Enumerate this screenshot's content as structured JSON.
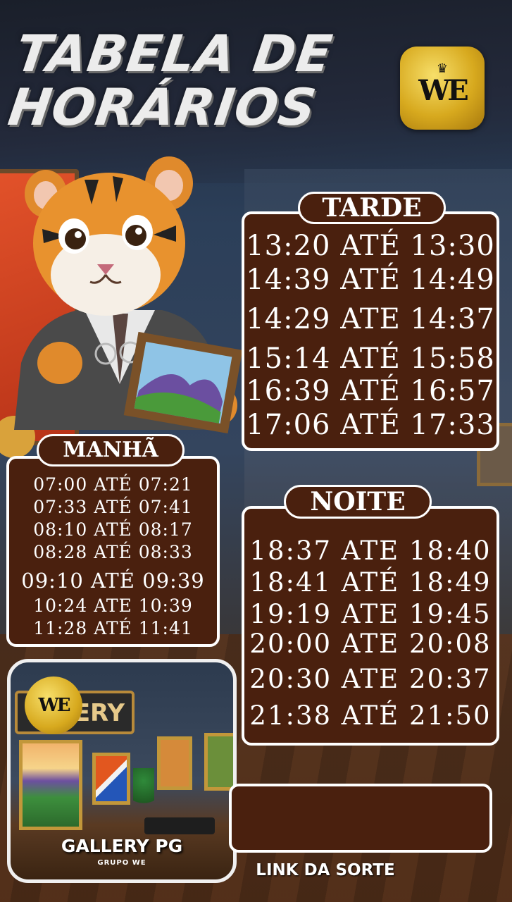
{
  "header": {
    "title_line1": "TABELA DE",
    "title_line2": "HORÁRIOS",
    "logo_mark": "WE"
  },
  "tarde": {
    "label": "TARDE",
    "rows": [
      "13:20 ATÉ 13:30",
      "14:39 ATÉ 14:49",
      "14:29 ATE 14:37",
      "15:14 ATÉ 15:58",
      "16:39 ATÉ 16:57",
      "17:06 ATÉ 17:33"
    ]
  },
  "manha": {
    "label": "MANHÃ",
    "rows": [
      "07:00 ATÉ 07:21",
      "07:33 ATÉ 07:41",
      "08:10 ATÉ 08:17",
      "08:28 ATÉ 08:33",
      "09:10 ATÉ 09:39",
      "10:24 ATE 10:39",
      "11:28 ATÉ 11:41"
    ]
  },
  "noite": {
    "label": "NOITE",
    "rows": [
      "18:37 ATE 18:40",
      "18:41 ATÉ 18:49",
      "19:19 ATE 19:45",
      "20:00 ATE 20:08",
      "20:30 ATE 20:37",
      "21:38 ATÉ 21:50"
    ]
  },
  "gallery": {
    "sign": "LLERY",
    "logo_mark": "WE",
    "title": "GALLERY PG",
    "subtitle": "GRUPO WE"
  },
  "link": {
    "label": "LINK DA SORTE"
  },
  "colors": {
    "panel": "#4a200e",
    "border": "#ffffff",
    "gold": "#d7a91e"
  }
}
